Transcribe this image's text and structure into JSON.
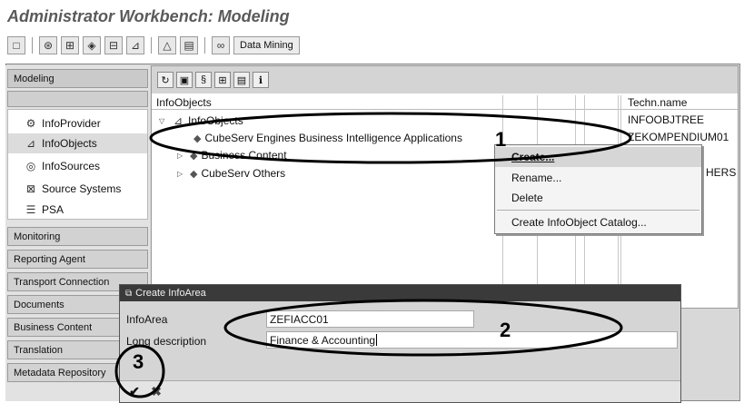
{
  "app": {
    "title": "Administrator Workbench: Modeling"
  },
  "toolbar": {
    "icons": [
      "window-icon",
      "binoculars-icon",
      "hierarchy-icon",
      "cube-icon",
      "database-icon",
      "infoobject-icon",
      "triangle-icon",
      "document-icon",
      "link-icon"
    ],
    "data_mining_label": "Data Mining"
  },
  "nav": {
    "header": "Modeling",
    "items": [
      {
        "label": "InfoProvider",
        "icon": "infoprovider-icon"
      },
      {
        "label": "InfoObjects",
        "icon": "infoobject-icon",
        "selected": true
      },
      {
        "label": "InfoSources",
        "icon": "infosource-icon"
      },
      {
        "label": "Source Systems",
        "icon": "source-system-icon"
      },
      {
        "label": "PSA",
        "icon": "psa-icon"
      }
    ],
    "sections": [
      "Monitoring",
      "Reporting Agent",
      "Transport Connection",
      "Documents",
      "Business Content",
      "Translation",
      "Metadata Repository"
    ]
  },
  "tree": {
    "col_infoobjects": "InfoObjects",
    "col_techn": "Techn.name",
    "rows": [
      {
        "label": "InfoObjects",
        "techn": "INFOOBJTREE"
      },
      {
        "label": "CubeServ Engines Business Intelligence Applications",
        "techn": "ZEKOMPENDIUM01"
      },
      {
        "label": "Business Content",
        "techn": ""
      },
      {
        "label": "CubeServ Others",
        "techn": "HERS"
      }
    ]
  },
  "context_menu": {
    "items": [
      "Create...",
      "Rename...",
      "Delete",
      "Create InfoObject Catalog..."
    ]
  },
  "dialog": {
    "title": "Create InfoArea",
    "infoarea_label": "InfoArea",
    "infoarea_value": "ZEFIACC01",
    "longdesc_label": "Long description",
    "longdesc_value": "Finance & Accounting"
  },
  "annotations": {
    "one": "1",
    "two": "2",
    "three": "3"
  }
}
